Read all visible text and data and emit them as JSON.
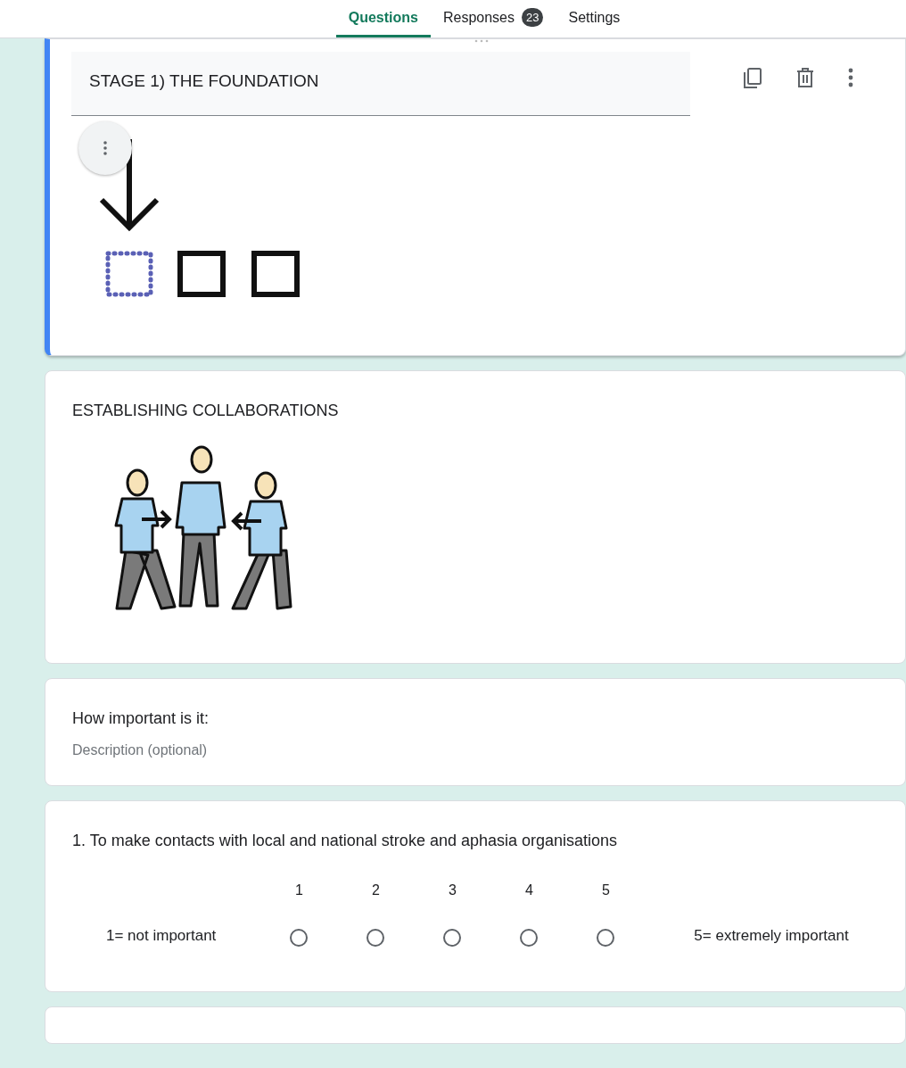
{
  "tabs": [
    {
      "label": "Questions",
      "selected": true
    },
    {
      "label": "Responses",
      "selected": false,
      "badge": "23"
    },
    {
      "label": "Settings",
      "selected": false
    }
  ],
  "cards": [
    {
      "kind": "header_image",
      "active": true,
      "title": "STAGE 1) THE FOUNDATION",
      "image": {
        "kind": "arrow_boxes"
      }
    },
    {
      "kind": "image",
      "active": false,
      "title": "ESTABLISHING COLLABORATIONS",
      "image": {
        "kind": "people"
      }
    },
    {
      "kind": "section",
      "active": false,
      "title": "How important is it:",
      "placeholder": "Description (optional)"
    },
    {
      "kind": "scale",
      "active": false,
      "title": "1. To make contacts with local and national stroke and aphasia organisations",
      "low_label": "1= not important",
      "high_label": "5= extremely important",
      "options": [
        {
          "label": "1",
          "selected": false
        },
        {
          "label": "2",
          "selected": false
        },
        {
          "label": "3",
          "selected": false
        },
        {
          "label": "4",
          "selected": false
        },
        {
          "label": "5",
          "selected": false
        }
      ]
    },
    {
      "kind": "blank",
      "active": false
    }
  ]
}
